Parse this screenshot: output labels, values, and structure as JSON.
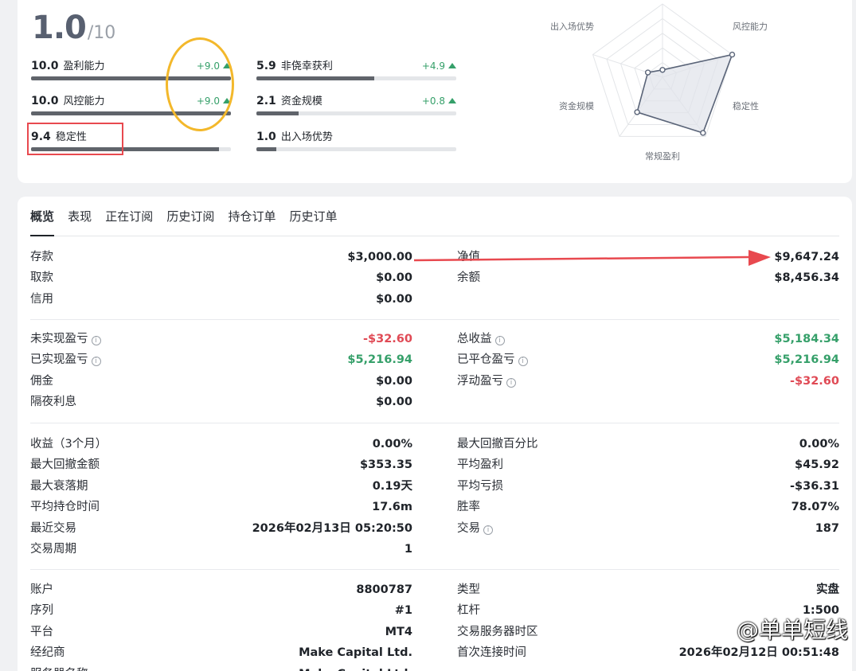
{
  "score": {
    "value": "1.0",
    "max": "/10"
  },
  "metrics": [
    {
      "value": "10.0",
      "label": "盈利能力",
      "delta": "+9.0",
      "fill": 1.0
    },
    {
      "value": "5.9",
      "label": "非侥幸获利",
      "delta": "+4.9",
      "fill": 0.59
    },
    {
      "value": "10.0",
      "label": "风控能力",
      "delta": "+9.0",
      "fill": 1.0
    },
    {
      "value": "2.1",
      "label": "资金规模",
      "delta": "+0.8",
      "fill": 0.21
    },
    {
      "value": "9.4",
      "label": "稳定性",
      "delta": "",
      "fill": 0.94
    },
    {
      "value": "1.0",
      "label": "出入场优势",
      "delta": "",
      "fill": 0.1
    }
  ],
  "radar": {
    "axes": [
      "出入场优势",
      "风控能力",
      "稳定性",
      "常规盈利",
      "资金规模"
    ],
    "values": [
      1.0,
      10.0,
      9.4,
      5.9,
      2.1
    ],
    "max": 10,
    "stroke": "#5a6478",
    "fill": "#dfe3ea"
  },
  "tabs": [
    "概览",
    "表现",
    "正在订阅",
    "历史订阅",
    "持仓订单",
    "历史订单"
  ],
  "sections": [
    {
      "left": [
        {
          "k": "存款",
          "v": "$3,000.00"
        },
        {
          "k": "取款",
          "v": "$0.00"
        },
        {
          "k": "信用",
          "v": "$0.00"
        }
      ],
      "right": [
        {
          "k": "净值",
          "v": "$9,647.24"
        },
        {
          "k": "余额",
          "v": "$8,456.34"
        }
      ]
    },
    {
      "left": [
        {
          "k": "未实现盈亏",
          "v": "-$32.60",
          "tone": "neg",
          "info": true
        },
        {
          "k": "已实现盈亏",
          "v": "$5,216.94",
          "tone": "pos",
          "info": true
        },
        {
          "k": "佣金",
          "v": "$0.00"
        },
        {
          "k": "隔夜利息",
          "v": "$0.00"
        }
      ],
      "right": [
        {
          "k": "总收益",
          "v": "$5,184.34",
          "tone": "pos",
          "info": true
        },
        {
          "k": "已平仓盈亏",
          "v": "$5,216.94",
          "tone": "pos",
          "info": true
        },
        {
          "k": "浮动盈亏",
          "v": "-$32.60",
          "tone": "neg",
          "info": true
        }
      ]
    },
    {
      "left": [
        {
          "k": "收益（3个月）",
          "v": "0.00%"
        },
        {
          "k": "最大回撤金额",
          "v": "$353.35"
        },
        {
          "k": "最大衰落期",
          "v": "0.19天"
        },
        {
          "k": "平均持仓时间",
          "v": "17.6m"
        },
        {
          "k": "最近交易",
          "v": "2026年02月13日 05:20:50"
        },
        {
          "k": "交易周期",
          "v": "1"
        }
      ],
      "right": [
        {
          "k": "最大回撤百分比",
          "v": "0.00%"
        },
        {
          "k": "平均盈利",
          "v": "$45.92"
        },
        {
          "k": "平均亏损",
          "v": "-$36.31"
        },
        {
          "k": "胜率",
          "v": "78.07%"
        },
        {
          "k": "交易",
          "v": "187",
          "info": true
        }
      ]
    },
    {
      "left": [
        {
          "k": "账户",
          "v": "8800787"
        },
        {
          "k": "序列",
          "v": "#1"
        },
        {
          "k": "平台",
          "v": "MT4"
        },
        {
          "k": "经纪商",
          "v": "Make Capital Ltd."
        },
        {
          "k": "服务器名称",
          "v": "Make Capital Ltd."
        }
      ],
      "right": [
        {
          "k": "类型",
          "v": "实盘"
        },
        {
          "k": "杠杆",
          "v": "1:500"
        },
        {
          "k": "交易服务器时区",
          "v": ""
        },
        {
          "k": "首次连接时间",
          "v": "2026年02月12日 00:51:48"
        }
      ]
    }
  ],
  "watermark": "@单单短线",
  "colors": {
    "positive": "#36a06a",
    "negative": "#e04a55",
    "highlight_ellipse": "#f3b82b",
    "highlight_rect": "#e8494f",
    "arrow": "#e8494f"
  }
}
